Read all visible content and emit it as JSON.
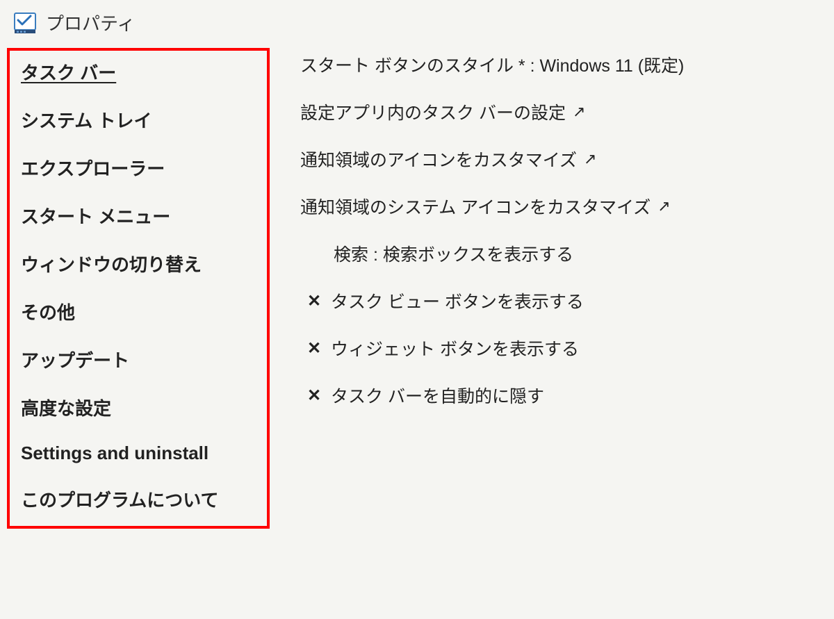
{
  "titlebar": {
    "title": "プロパティ"
  },
  "sidebar": {
    "items": [
      {
        "label": "タスク バー",
        "active": true
      },
      {
        "label": "システム トレイ",
        "active": false
      },
      {
        "label": "エクスプローラー",
        "active": false
      },
      {
        "label": "スタート メニュー",
        "active": false
      },
      {
        "label": "ウィンドウの切り替え",
        "active": false
      },
      {
        "label": "その他",
        "active": false
      },
      {
        "label": "アップデート",
        "active": false
      },
      {
        "label": "高度な設定",
        "active": false
      },
      {
        "label": "Settings and uninstall",
        "active": false
      },
      {
        "label": "このプログラムについて",
        "active": false
      }
    ]
  },
  "content": {
    "rows": [
      {
        "prefix": "",
        "label": "スタート ボタンのスタイル * : Windows 11 (既定)",
        "suffix": "",
        "indented": false
      },
      {
        "prefix": "",
        "label": "設定アプリ内のタスク バーの設定",
        "suffix": "↗",
        "indented": false
      },
      {
        "prefix": "",
        "label": "通知領域のアイコンをカスタマイズ",
        "suffix": "↗",
        "indented": false
      },
      {
        "prefix": "",
        "label": "通知領域のシステム アイコンをカスタマイズ",
        "suffix": "↗",
        "indented": false
      },
      {
        "prefix": "",
        "label": "検索 : 検索ボックスを表示する",
        "suffix": "",
        "indented": true
      },
      {
        "prefix": "✕",
        "label": "タスク ビュー ボタンを表示する",
        "suffix": "",
        "indented": false
      },
      {
        "prefix": "✕",
        "label": "ウィジェット ボタンを表示する",
        "suffix": "",
        "indented": false
      },
      {
        "prefix": "✕",
        "label": "タスク バーを自動的に隠す",
        "suffix": "",
        "indented": false
      }
    ]
  }
}
